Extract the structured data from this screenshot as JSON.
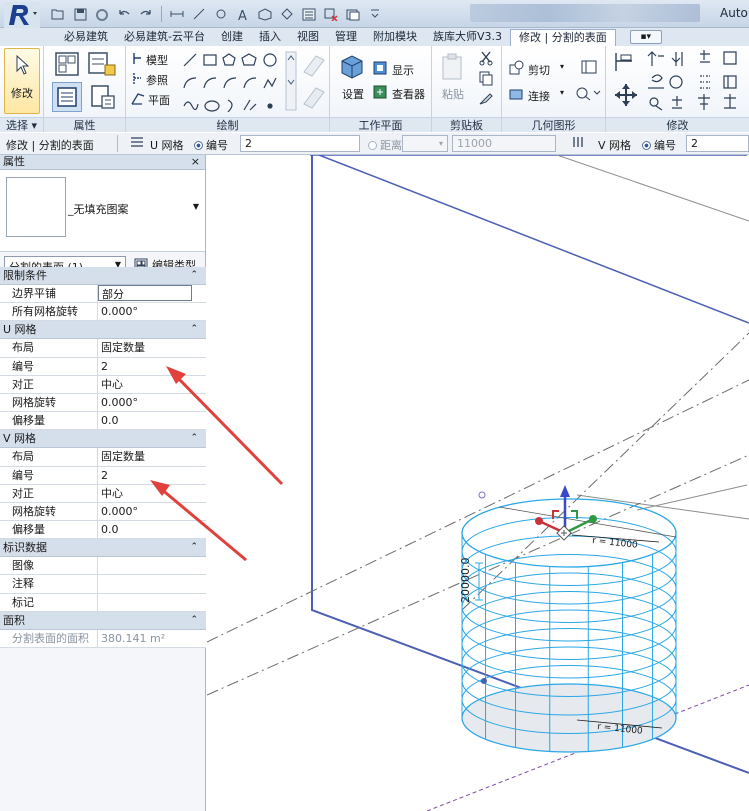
{
  "title_bar": {
    "app_title": "Auto"
  },
  "tabs": [
    {
      "label": "必易建筑"
    },
    {
      "label": "必易建筑-云平台"
    },
    {
      "label": "创建"
    },
    {
      "label": "插入"
    },
    {
      "label": "视图"
    },
    {
      "label": "管理"
    },
    {
      "label": "附加模块"
    },
    {
      "label": "族库大师V3.3"
    },
    {
      "label": "修改 | 分割的表面"
    }
  ],
  "ribbon": {
    "select_panel": {
      "button": "修改",
      "label": "选择 ▾"
    },
    "properties_panel": {
      "label": "属性"
    },
    "draw_panel": {
      "label": "绘制",
      "model": "模型",
      "reference": "参照",
      "plane": "平面"
    },
    "workplane_panel": {
      "label": "工作平面",
      "set": "设置",
      "show": "显示",
      "viewer": "查看器"
    },
    "clipboard_panel": {
      "label": "剪贴板",
      "paste": "粘贴"
    },
    "geometry_panel": {
      "label": "几何图形",
      "cut": "剪切",
      "join": "连接"
    },
    "modify_panel": {
      "label": "修改"
    }
  },
  "options_bar": {
    "context": "修改 | 分割的表面",
    "u_grid_label": "U 网格",
    "u_number_label": "编号",
    "u_number_value": "2",
    "distance_label": "距离",
    "distance_value": "11000",
    "v_grid_label": "V 网格",
    "v_number_label": "编号",
    "v_number_value": "2"
  },
  "properties": {
    "header": "属性",
    "close": "×",
    "type_name": "_无填充图案",
    "selector": "分割的表面 (1)",
    "edit_type": "编辑类型",
    "sections": [
      {
        "title": "限制条件",
        "rows": [
          {
            "name": "边界平铺",
            "value": "部分"
          },
          {
            "name": "所有网格旋转",
            "value": "0.000°"
          }
        ]
      },
      {
        "title": "U 网格",
        "rows": [
          {
            "name": "布局",
            "value": "固定数量"
          },
          {
            "name": "编号",
            "value": "2"
          },
          {
            "name": "对正",
            "value": "中心"
          },
          {
            "name": "网格旋转",
            "value": "0.000°"
          },
          {
            "name": "偏移量",
            "value": "0.0"
          }
        ]
      },
      {
        "title": "V 网格",
        "rows": [
          {
            "name": "布局",
            "value": "固定数量"
          },
          {
            "name": "编号",
            "value": "2"
          },
          {
            "name": "对正",
            "value": "中心"
          },
          {
            "name": "网格旋转",
            "value": "0.000°"
          },
          {
            "name": "偏移量",
            "value": "0.0"
          }
        ]
      },
      {
        "title": "标识数据",
        "rows": [
          {
            "name": "图像",
            "value": ""
          },
          {
            "name": "注释",
            "value": ""
          },
          {
            "name": "标记",
            "value": ""
          }
        ]
      },
      {
        "title": "面积",
        "rows": [
          {
            "name": "分割表面的面积",
            "value": "380.141 m²"
          }
        ]
      }
    ]
  },
  "viewport": {
    "height_dim": "20000.0",
    "top_dim": "r = 11000",
    "bottom_dim": "r = 11000"
  },
  "colors": {
    "accent": "#3a7fd5",
    "cylinder": "#2aa7e6",
    "arrow": "#e0413c",
    "plane": "#4b5fb5"
  }
}
